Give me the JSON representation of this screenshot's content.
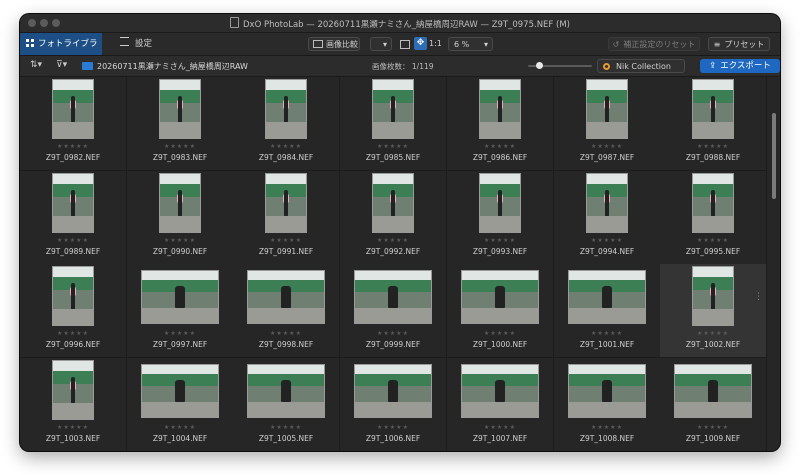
{
  "window": {
    "title": "DxO PhotoLab — 20260711黒瀬ナミさん_納屋橋周辺RAW — Z9T_0975.NEF (M)"
  },
  "toolbar": {
    "tab_library": "フォトライブラリ",
    "tab_settings": "設定",
    "compare_label": "画像比較",
    "one_to_one": "1:1",
    "zoom_value": "6 %",
    "reset_label": "補正設定のリセット",
    "preset_label": "プリセット"
  },
  "pathbar": {
    "folder_name": "20260711黒瀬ナミさん_納屋橋周辺RAW",
    "count_label": "画像枚数：",
    "count_value": "1/119",
    "nik_label": "Nik Collection",
    "export_label": "エクスポート"
  },
  "rating_placeholder": "★★★★★",
  "grid": {
    "rows": [
      [
        "Z9T_0982.NEF",
        "Z9T_0983.NEF",
        "Z9T_0984.NEF",
        "Z9T_0985.NEF",
        "Z9T_0986.NEF",
        "Z9T_0987.NEF",
        "Z9T_0988.NEF"
      ],
      [
        "Z9T_0989.NEF",
        "Z9T_0990.NEF",
        "Z9T_0991.NEF",
        "Z9T_0992.NEF",
        "Z9T_0993.NEF",
        "Z9T_0994.NEF",
        "Z9T_0995.NEF"
      ],
      [
        "Z9T_0996.NEF",
        "Z9T_0997.NEF",
        "Z9T_0998.NEF",
        "Z9T_0999.NEF",
        "Z9T_1000.NEF",
        "Z9T_1001.NEF",
        "Z9T_1002.NEF"
      ],
      [
        "Z9T_1003.NEF",
        "Z9T_1004.NEF",
        "Z9T_1005.NEF",
        "Z9T_1006.NEF",
        "Z9T_1007.NEF",
        "Z9T_1008.NEF",
        "Z9T_1009.NEF"
      ]
    ],
    "orientations": [
      [
        "portrait",
        "portrait",
        "portrait",
        "portrait",
        "portrait",
        "portrait",
        "portrait"
      ],
      [
        "portrait",
        "portrait",
        "portrait",
        "portrait",
        "portrait",
        "portrait",
        "portrait"
      ],
      [
        "portrait",
        "landscape",
        "landscape",
        "landscape",
        "landscape",
        "landscape",
        "portrait"
      ],
      [
        "portrait",
        "landscape",
        "landscape",
        "landscape",
        "landscape",
        "landscape",
        "landscape"
      ]
    ],
    "selected": "Z9T_1002.NEF"
  },
  "colors": {
    "accent": "#1d4f86",
    "export": "#1e68c2",
    "folder": "#2a7bd4"
  }
}
